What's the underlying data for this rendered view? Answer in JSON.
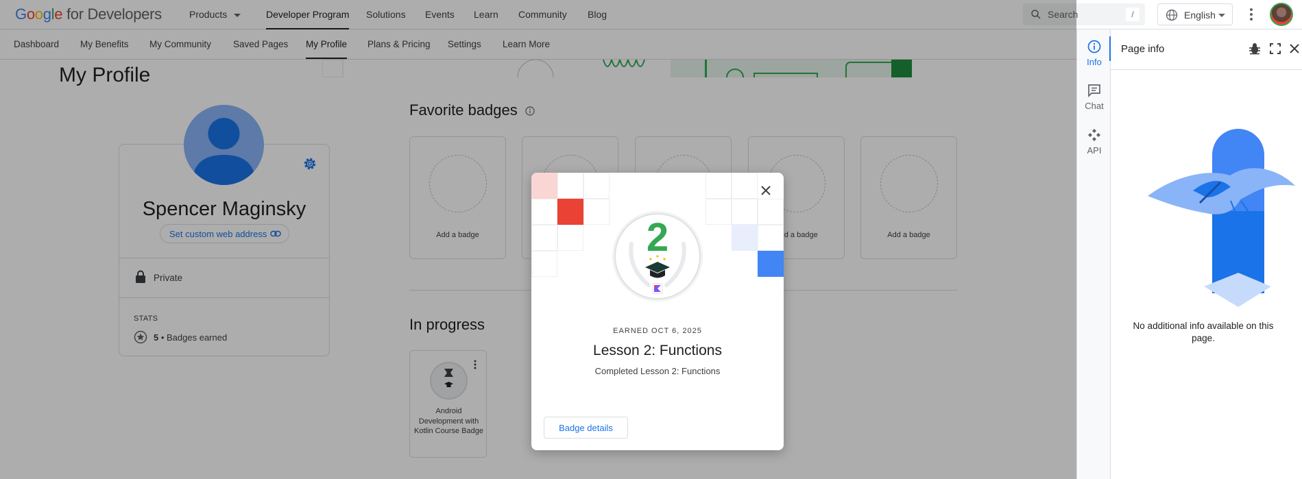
{
  "header": {
    "logo": {
      "g": "G",
      "o1": "o",
      "o2": "o",
      "g2": "g",
      "l": "l",
      "e": "e",
      "rest": " for Developers"
    },
    "nav": [
      "Products",
      "Developer Program",
      "Solutions",
      "Events",
      "Learn",
      "Community",
      "Blog"
    ],
    "active_nav": "Developer Program",
    "search": {
      "placeholder": "Search",
      "shortcut": "/"
    },
    "language": "English"
  },
  "subnav": {
    "items": [
      "Dashboard",
      "My Benefits",
      "My Community",
      "Saved Pages",
      "My Profile",
      "Plans & Pricing",
      "Settings",
      "Learn More"
    ],
    "active": "My Profile"
  },
  "profile": {
    "page_title": "My Profile",
    "name": "Spencer Maginsky",
    "custom_url_label": "Set custom web address",
    "visibility": "Private",
    "stats_label": "STATS",
    "badges_count": "5",
    "badges_suffix": " • Badges earned"
  },
  "favorite_badges": {
    "title": "Favorite badges",
    "slot_label": "Add a badge"
  },
  "in_progress": {
    "title": "In progress",
    "card_title": "Android Development with Kotlin Course Badge"
  },
  "side_panel": {
    "rail": [
      {
        "label": "Info",
        "icon": "info-icon"
      },
      {
        "label": "Chat",
        "icon": "chat-icon"
      },
      {
        "label": "API",
        "icon": "api-icon"
      }
    ],
    "active": "Info",
    "title": "Page info",
    "empty_message": "No additional info available on this page."
  },
  "modal": {
    "badge_number": "2",
    "earned": "EARNED OCT 6, 2025",
    "title": "Lesson 2: Functions",
    "description": "Completed Lesson 2: Functions",
    "button": "Badge details"
  },
  "colors": {
    "accent": "#1a73e8",
    "badge_green": "#34a853",
    "scrim": "rgba(0,0,0,0.32)"
  }
}
